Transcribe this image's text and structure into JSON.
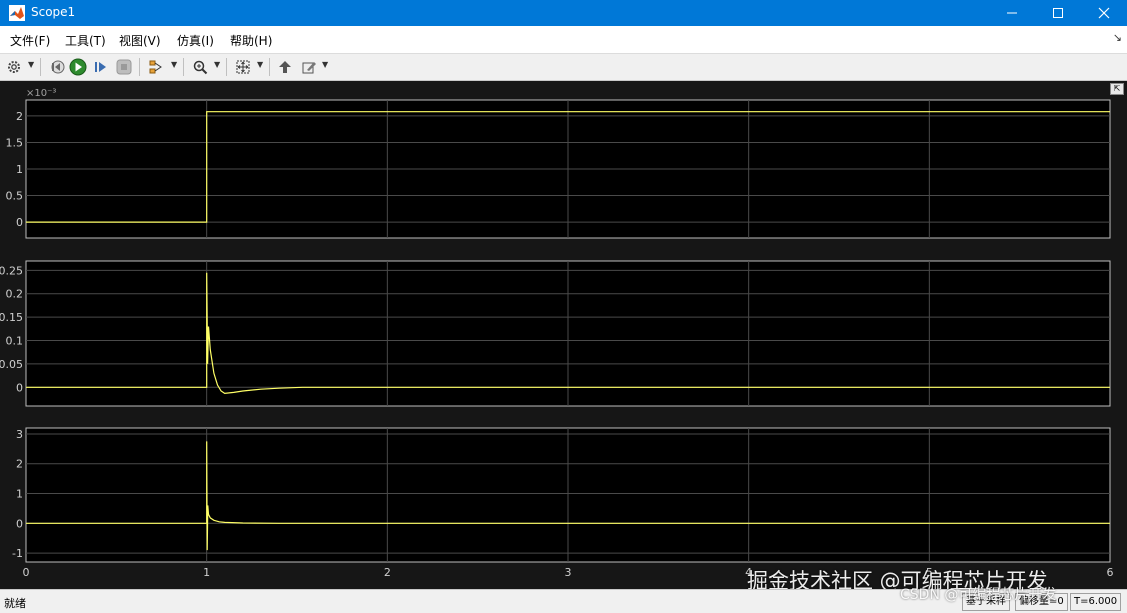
{
  "window": {
    "title": "Scope1"
  },
  "menu": [
    {
      "label": "文件(F)"
    },
    {
      "label": "工具(T)"
    },
    {
      "label": "视图(V)"
    },
    {
      "label": "仿真(I)"
    },
    {
      "label": "帮助(H)"
    }
  ],
  "toolbar": {
    "buttons": [
      "settings-icon",
      "step-back-icon",
      "run-icon",
      "step-forward-icon",
      "stop-icon",
      "signal-selector-icon",
      "zoom-icon",
      "fit-axes-icon",
      "highlight-block-icon",
      "style-icon"
    ]
  },
  "colors": {
    "signal": "#ffff66",
    "background": "#161616",
    "grid": "#4a4a4a",
    "axis_text": "#d0d0d0",
    "titlebar": "#0078d7"
  },
  "chart_data": [
    {
      "type": "line",
      "exponent_label": "×10⁻³",
      "xlim": [
        0,
        6
      ],
      "ylim": [
        -0.3,
        2.3
      ],
      "yticks": [
        {
          "label": "0",
          "v": 0
        },
        {
          "label": "0.5",
          "v": 0.5
        },
        {
          "label": "1",
          "v": 1
        },
        {
          "label": "1.5",
          "v": 1.5
        },
        {
          "label": "2",
          "v": 2
        }
      ],
      "grid": true,
      "series": [
        {
          "points": [
            [
              0,
              0
            ],
            [
              1,
              0
            ],
            [
              1,
              2.08
            ],
            [
              6,
              2.08
            ]
          ]
        }
      ]
    },
    {
      "type": "line",
      "xlim": [
        0,
        6
      ],
      "ylim": [
        -0.04,
        0.27
      ],
      "yticks": [
        {
          "label": "0",
          "v": 0
        },
        {
          "label": "0.05",
          "v": 0.05
        },
        {
          "label": "0.1",
          "v": 0.1
        },
        {
          "label": "0.15",
          "v": 0.15
        },
        {
          "label": "0.2",
          "v": 0.2
        },
        {
          "label": "0.25",
          "v": 0.25
        }
      ],
      "grid": true,
      "series": [
        {
          "points": [
            [
              0,
              0
            ],
            [
              1,
              0
            ],
            [
              1,
              0.245
            ],
            [
              1.005,
              0.05
            ],
            [
              1.01,
              0.13
            ],
            [
              1.02,
              0.08
            ],
            [
              1.04,
              0.03
            ],
            [
              1.06,
              0.005
            ],
            [
              1.08,
              -0.008
            ],
            [
              1.1,
              -0.013
            ],
            [
              1.15,
              -0.011
            ],
            [
              1.2,
              -0.008
            ],
            [
              1.3,
              -0.004
            ],
            [
              1.4,
              -0.002
            ],
            [
              1.53,
              0
            ],
            [
              6,
              0
            ]
          ]
        }
      ]
    },
    {
      "type": "line",
      "xlim": [
        0,
        6
      ],
      "ylim": [
        -1.3,
        3.2
      ],
      "yticks": [
        {
          "label": "-1",
          "v": -1
        },
        {
          "label": "0",
          "v": 0
        },
        {
          "label": "1",
          "v": 1
        },
        {
          "label": "2",
          "v": 2
        },
        {
          "label": "3",
          "v": 3
        }
      ],
      "xticks": [
        {
          "label": "0",
          "v": 0
        },
        {
          "label": "1",
          "v": 1
        },
        {
          "label": "2",
          "v": 2
        },
        {
          "label": "3",
          "v": 3
        },
        {
          "label": "4",
          "v": 4
        },
        {
          "label": "5",
          "v": 5
        },
        {
          "label": "6",
          "v": 6
        }
      ],
      "grid": true,
      "series": [
        {
          "points": [
            [
              0,
              0
            ],
            [
              1,
              0
            ],
            [
              1,
              2.75
            ],
            [
              1.003,
              -0.9
            ],
            [
              1.006,
              0.6
            ],
            [
              1.01,
              0.3
            ],
            [
              1.02,
              0.18
            ],
            [
              1.04,
              0.1
            ],
            [
              1.07,
              0.05
            ],
            [
              1.1,
              0.03
            ],
            [
              1.2,
              0.01
            ],
            [
              1.4,
              0
            ],
            [
              6,
              0
            ]
          ]
        }
      ]
    }
  ],
  "status": {
    "text": "就绪",
    "mode": "基于采样",
    "offset": "偏移量=0",
    "time": "T=6.000"
  },
  "watermark": {
    "line1": "掘金技术社区 @可编程芯片开发",
    "line2": "CSDN @可编程芯片开发"
  }
}
